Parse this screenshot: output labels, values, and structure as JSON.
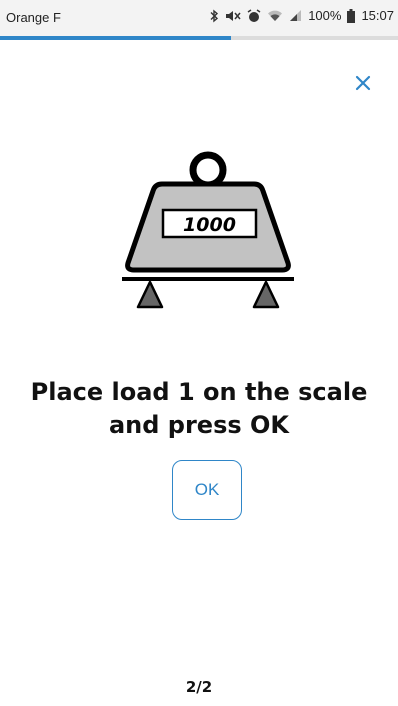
{
  "status_bar": {
    "carrier": "Orange F",
    "battery_percent": "100%",
    "time": "15:07",
    "icons": [
      "bluetooth-icon",
      "mute-icon",
      "alarm-icon",
      "wifi-icon",
      "signal-icon",
      "battery-icon"
    ]
  },
  "progress": {
    "fraction": 0.58,
    "color": "#2f86c8",
    "track_color": "#dcdcdc"
  },
  "close_button": {
    "icon": "close-icon",
    "color": "#2f86c8"
  },
  "illustration": {
    "weight_value": "1000",
    "icon": "scale-weight-icon"
  },
  "instruction": {
    "line1": "Place load 1 on the scale",
    "line2": "and press OK"
  },
  "ok_button": {
    "label": "OK",
    "color": "#2f86c8"
  },
  "pagination": {
    "label": "2/2"
  }
}
